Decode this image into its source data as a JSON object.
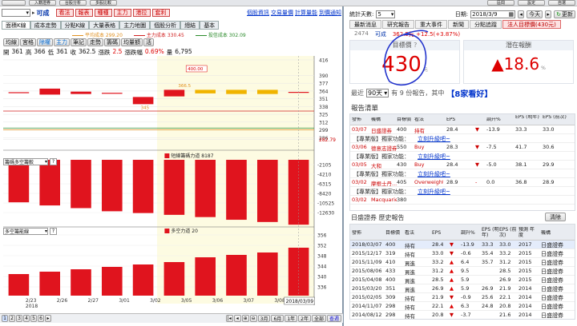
{
  "topbar": {
    "left_items": [
      "",
      "入籍證券",
      "台股分析",
      "多股比較"
    ],
    "right_items": [
      "區間",
      "設定",
      "自選"
    ]
  },
  "stockbar": {
    "code": "",
    "name": "可成",
    "buttons": [
      "看法",
      "報表",
      "種種",
      "主力",
      "港拉",
      "套利"
    ],
    "links": [
      "個股資訊",
      "交易量價",
      "計算量能",
      "到價通知"
    ]
  },
  "chart_tabs": [
    "面積K線",
    "成本走勢",
    "分點K線",
    "大量表格",
    "主力地圖",
    "個股分析",
    "總結",
    "基本"
  ],
  "legend": {
    "ma1": "平均成本 299.20",
    "ma2": "主力成本 330.45",
    "ma3": "投信成本 302.09"
  },
  "tools": [
    "均線",
    "宮格",
    "除權",
    "主力",
    "筆記",
    "走勢",
    "籌碼",
    "均量額",
    "活"
  ],
  "ohlc": {
    "open_label": "開",
    "open": "361",
    "high_label": "高",
    "high": "366",
    "low_label": "低",
    "low": "361",
    "close_label": "收",
    "close": "362.5",
    "chg_label": "漲跌",
    "chg": "2.5",
    "pct_label": "漲跌幅",
    "pct": "0.69%",
    "vol_label": "量",
    "vol": "6,795"
  },
  "chart_data": [
    {
      "type": "bar",
      "panel": "price",
      "categories": [
        "2/23",
        "2/26",
        "2/27",
        "3/01",
        "3/02",
        "3/05",
        "3/06",
        "3/07",
        "3/08",
        "3/09"
      ],
      "ylim": [
        265,
        420
      ],
      "y_ticks": [
        "416",
        "390",
        "377",
        "364",
        "351",
        "338",
        "325",
        "312",
        "299",
        "286",
        "282.79"
      ],
      "annotations": [
        "400.00",
        "366.5",
        "345"
      ],
      "candles": [
        {
          "o": 362,
          "c": 362
        },
        {
          "o": 358,
          "c": 368
        },
        {
          "o": 359,
          "c": 363
        },
        {
          "o": 360,
          "c": 361
        },
        {
          "o": 342,
          "c": 354
        },
        {
          "o": 355,
          "c": 366
        },
        {
          "o": 366,
          "c": 360
        },
        {
          "o": 366,
          "c": 359
        },
        {
          "o": 366,
          "c": 359
        },
        {
          "o": 361,
          "c": 362.5
        }
      ]
    },
    {
      "type": "bar",
      "panel": "indicator1",
      "title": "短線籌碼力道 8187",
      "ylim": [
        -15000,
        0
      ],
      "y_ticks": [
        "-2105",
        "-4210",
        "-6315",
        "-8420",
        "-10525",
        "-12630"
      ],
      "values": [
        -9500,
        -10200,
        -10800,
        -11500,
        -11900,
        -12300,
        -12800,
        -13400,
        -13900,
        -14500
      ]
    },
    {
      "type": "bar",
      "panel": "indicator2",
      "title": "多空力道 20",
      "ylim": [
        332,
        358
      ],
      "y_ticks": [
        "356",
        "352",
        "348",
        "344",
        "340",
        "336"
      ],
      "values": [
        341,
        342,
        343,
        344,
        345,
        346,
        348,
        349,
        350,
        352
      ]
    }
  ],
  "x_labels": [
    "2/23",
    "2/26",
    "2/27",
    "3/01",
    "3/02",
    "3/05",
    "3/06",
    "3/07",
    "3/08"
  ],
  "x_year": "2018",
  "cursor_date": "2018/03/09",
  "ind1_select": "籌碼多空籌較",
  "ind2_select": "多空籌能線",
  "bottom_nav": {
    "pages": [
      "1",
      "2",
      "3",
      "4",
      "5",
      "6"
    ],
    "zoom": [
      "3月",
      "6月",
      "1年",
      "2年",
      "全部",
      "查週"
    ]
  },
  "right": {
    "period_label": "統計天數:",
    "period_value": "5",
    "date_label": "日期:",
    "date_value": "2018/3/9",
    "today_label": "今天",
    "refresh_label": "更新",
    "tabs": [
      "最新消息",
      "研究報告",
      "重大事件",
      "新聞",
      "分點追蹤",
      "法人目標價(430元)"
    ],
    "stock_code": "2474",
    "stock_name": "可成",
    "stock_line": "362.5元 +12.5(+3.87%)",
    "target_label": "目標價",
    "target_value": "430",
    "q_mark": "?",
    "target_unit": "元",
    "upside_label": "潛在報酬",
    "upside_value": "▲18.6",
    "upside_unit": "%",
    "recent_label": "最近",
    "recent_value": "90天",
    "recent_count": "有 9 份報告，其中",
    "recent_highlight": "【8家看好】",
    "report_list_title": "報告清單",
    "report_headers": [
      "發佈",
      "機構",
      "目標價",
      "看法",
      "EPS",
      "",
      "調升%",
      "EPS (明年)",
      "EPS (前次)"
    ],
    "reports": [
      {
        "date": "03/07",
        "org": "日盛證券",
        "target": "400",
        "view": "持有",
        "eps": "28.4",
        "arrow": "▼",
        "pct": "-13.9",
        "eps_next": "33.3",
        "eps_prev": "33.0"
      },
      {
        "note": "【專業版】獨家功能：",
        "link": "立刻升級吧~"
      },
      {
        "date": "03/06",
        "org": "德意志證券",
        "target": "550",
        "view": "Buy",
        "eps": "28.3",
        "arrow": "▼",
        "pct": "-7.5",
        "eps_next": "41.7",
        "eps_prev": "30.6"
      },
      {
        "note": "【專業版】獨家功能：",
        "link": "立刻升級吧~"
      },
      {
        "date": "03/05",
        "org": "大和",
        "target": "430",
        "view": "Buy",
        "eps": "28.4",
        "arrow": "▼",
        "pct": "-5.0",
        "eps_next": "38.1",
        "eps_prev": "29.9"
      },
      {
        "note": "【專業版】獨家功能：",
        "link": "立刻升級吧~"
      },
      {
        "date": "03/02",
        "org": "摩根士丹...",
        "target": "405",
        "view": "Overweight",
        "eps": "28.9",
        "arrow": "-",
        "pct": "0.0",
        "eps_next": "36.8",
        "eps_prev": "28.9"
      },
      {
        "note": "【專業版】獨家功能：",
        "link": "立刻升級吧~"
      },
      {
        "date": "03/02",
        "org": "Macquarie",
        "target": "380",
        "view": "",
        "eps": "",
        "arrow": "",
        "pct": "",
        "eps_next": "",
        "eps_prev": ""
      }
    ],
    "history_title": "日盛證券 歷史報告",
    "history_btn": "清除",
    "history_headers": [
      "發佈",
      "目標價",
      "看法",
      "EPS",
      "",
      "調升%",
      "EPS (明年)",
      "EPS (前次)",
      "預測 年度",
      "機構"
    ],
    "history": [
      {
        "date": "2018/03/07",
        "target": "400",
        "view": "持有",
        "eps": "28.4",
        "arrow": "▼",
        "pct": "-13.9",
        "next": "33.3",
        "prev": "33.0",
        "year": "2017",
        "org": "日盛證券"
      },
      {
        "date": "2015/12/17",
        "target": "319",
        "view": "持有",
        "eps": "33.0",
        "arrow": "▼",
        "pct": "-0.6",
        "next": "35.4",
        "prev": "33.2",
        "year": "2015",
        "org": "日盛證券"
      },
      {
        "date": "2015/11/09",
        "target": "410",
        "view": "買進",
        "eps": "33.2",
        "arrow": "▲",
        "pct": "6.4",
        "next": "35.7",
        "prev": "31.2",
        "year": "2015",
        "org": "日盛證券"
      },
      {
        "date": "2015/08/06",
        "target": "433",
        "view": "買進",
        "eps": "31.2",
        "arrow": "▲",
        "pct": "9.5",
        "next": "",
        "prev": "28.5",
        "year": "2015",
        "org": "日盛證券"
      },
      {
        "date": "2015/04/08",
        "target": "400",
        "view": "買進",
        "eps": "28.5",
        "arrow": "▲",
        "pct": "5.9",
        "next": "",
        "prev": "26.9",
        "year": "2015",
        "org": "日盛證券"
      },
      {
        "date": "2015/03/20",
        "target": "351",
        "view": "買進",
        "eps": "26.9",
        "arrow": "▲",
        "pct": "5.9",
        "next": "26.9",
        "prev": "21.9",
        "year": "2014",
        "org": "日盛證券"
      },
      {
        "date": "2015/02/05",
        "target": "309",
        "view": "持有",
        "eps": "21.9",
        "arrow": "▼",
        "pct": "-0.9",
        "next": "25.6",
        "prev": "22.1",
        "year": "2014",
        "org": "日盛證券"
      },
      {
        "date": "2014/11/07",
        "target": "298",
        "view": "持有",
        "eps": "22.1",
        "arrow": "▲",
        "pct": "6.3",
        "next": "24.8",
        "prev": "20.8",
        "year": "2014",
        "org": "日盛證券"
      },
      {
        "date": "2014/08/12",
        "target": "298",
        "view": "持有",
        "eps": "20.8",
        "arrow": "▼",
        "pct": "-3.7",
        "next": "",
        "prev": "21.6",
        "year": "2014",
        "org": "日盛證券"
      }
    ]
  }
}
